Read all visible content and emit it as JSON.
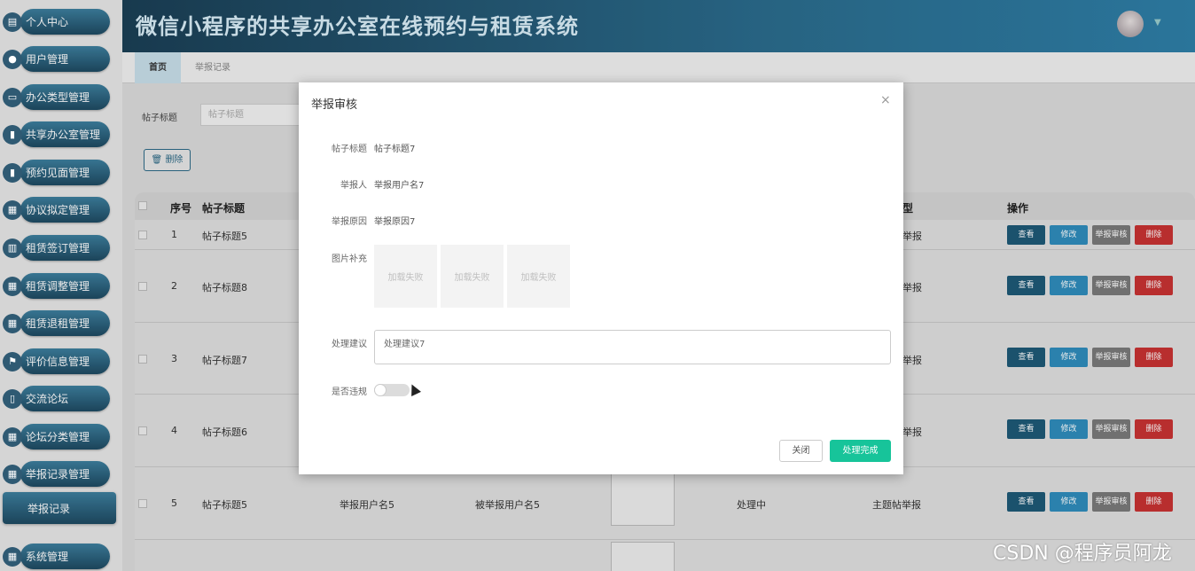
{
  "app_title": "微信小程序的共享办公室在线预约与租赁系统",
  "sidebar": {
    "items": [
      {
        "label": "个人中心",
        "icon": "profile-icon"
      },
      {
        "label": "用户管理",
        "icon": "user-icon"
      },
      {
        "label": "办公类型管理",
        "icon": "monitor-icon"
      },
      {
        "label": "共享办公室管理",
        "icon": "clipboard-icon"
      },
      {
        "label": "预约见面管理",
        "icon": "clipboard-icon"
      },
      {
        "label": "协议拟定管理",
        "icon": "grid-icon"
      },
      {
        "label": "租赁签订管理",
        "icon": "chart-icon"
      },
      {
        "label": "租赁调整管理",
        "icon": "grid-icon"
      },
      {
        "label": "租赁退租管理",
        "icon": "grid-icon"
      },
      {
        "label": "评价信息管理",
        "icon": "flag-icon"
      },
      {
        "label": "交流论坛",
        "icon": "book-icon"
      },
      {
        "label": "论坛分类管理",
        "icon": "grid-icon"
      },
      {
        "label": "举报记录管理",
        "icon": "grid-icon"
      },
      {
        "label": "系统管理",
        "icon": "grid-icon"
      }
    ],
    "sub_item": "举报记录"
  },
  "tabs": [
    {
      "label": "首页"
    },
    {
      "label": "举报记录"
    }
  ],
  "search": {
    "label": "帖子标题",
    "placeholder": "帖子标题"
  },
  "delete_button": "删除",
  "table": {
    "headers": {
      "index": "序号",
      "title": "帖子标题",
      "type": "型",
      "ops": "操作"
    },
    "rows": [
      {
        "index": "1",
        "title": "帖子标题5",
        "type": "举报"
      },
      {
        "index": "2",
        "title": "帖子标题8",
        "type": "举报"
      },
      {
        "index": "3",
        "title": "帖子标题7",
        "type": "举报"
      },
      {
        "index": "4",
        "title": "帖子标题6",
        "type": "举报"
      },
      {
        "index": "5",
        "title": "帖子标题5",
        "reporter": "举报用户名5",
        "reported": "被举报用户名5",
        "status": "处理中",
        "type": "主题帖举报"
      }
    ],
    "buttons": {
      "view": "查看",
      "edit": "修改",
      "audit": "举报审核",
      "delete": "删除"
    }
  },
  "modal": {
    "title": "举报审核",
    "fields": {
      "post_title_label": "帖子标题",
      "post_title": "帖子标题7",
      "reporter_label": "举报人",
      "reporter": "举报用户名7",
      "reason_label": "举报原因",
      "reason": "举报原因7",
      "images_label": "图片补充",
      "suggestion_label": "处理建议",
      "suggestion": "处理建议7",
      "violation_label": "是否违规"
    },
    "image_failed": [
      "加载失败",
      "加载失败",
      "加载失败"
    ],
    "close_button": "关闭",
    "done_button": "处理完成"
  },
  "watermark": "CSDN @程序员阿龙"
}
